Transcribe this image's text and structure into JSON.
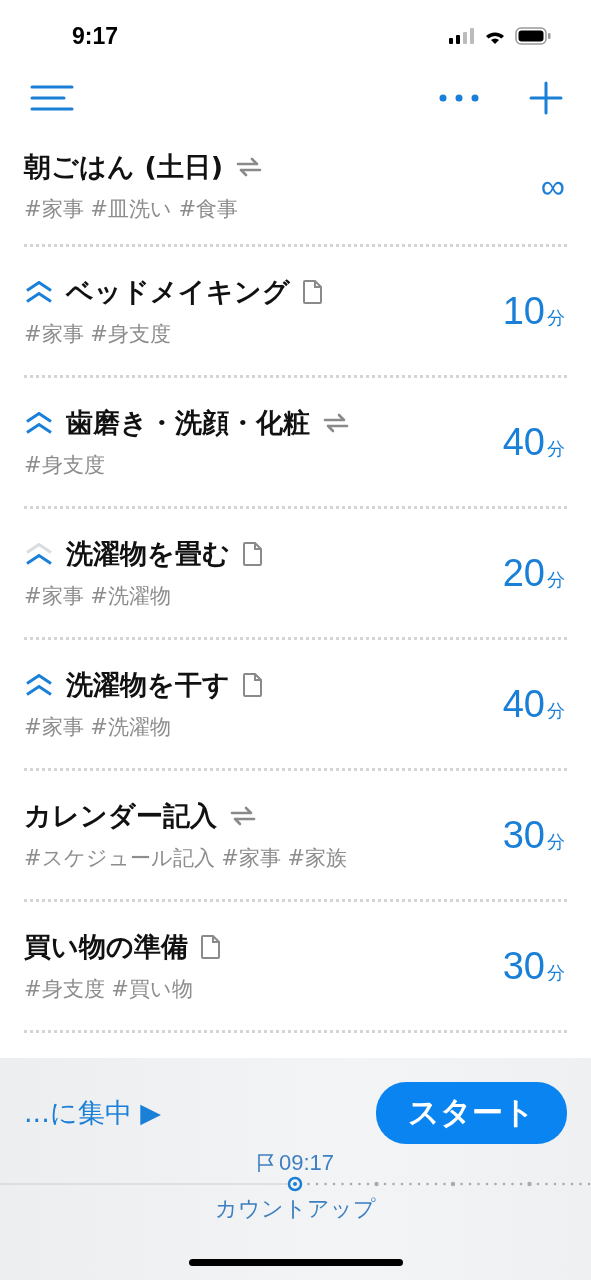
{
  "status_bar": {
    "time": "9:17"
  },
  "tasks": [
    {
      "title": "朝ごはん (土日)",
      "prioritized": false,
      "kind": "repeat",
      "tags": "#家事 #皿洗い #食事",
      "duration": "∞"
    },
    {
      "title": "ベッドメイキング",
      "prioritized": true,
      "high": true,
      "kind": "note",
      "tags": "#家事 #身支度",
      "duration": "10",
      "unit": "分"
    },
    {
      "title": "歯磨き・洗顔・化粧",
      "prioritized": true,
      "high": true,
      "kind": "repeat",
      "tags": "#身支度",
      "duration": "40",
      "unit": "分"
    },
    {
      "title": "洗濯物を畳む",
      "prioritized": true,
      "high": false,
      "kind": "note",
      "tags": "#家事 #洗濯物",
      "duration": "20",
      "unit": "分"
    },
    {
      "title": "洗濯物を干す",
      "prioritized": true,
      "high": true,
      "kind": "note",
      "tags": "#家事 #洗濯物",
      "duration": "40",
      "unit": "分"
    },
    {
      "title": "カレンダー記入",
      "prioritized": false,
      "kind": "repeat",
      "tags": "#スケジュール記入 #家事 #家族",
      "duration": "30",
      "unit": "分"
    },
    {
      "title": "買い物の準備",
      "prioritized": false,
      "kind": "note",
      "tags": "#身支度 #買い物",
      "duration": "30",
      "unit": "分"
    }
  ],
  "footer": {
    "focus": "...に集中 ▶",
    "start_button": "スタート",
    "flag_time": "09:17",
    "mode": "カウントアップ"
  }
}
